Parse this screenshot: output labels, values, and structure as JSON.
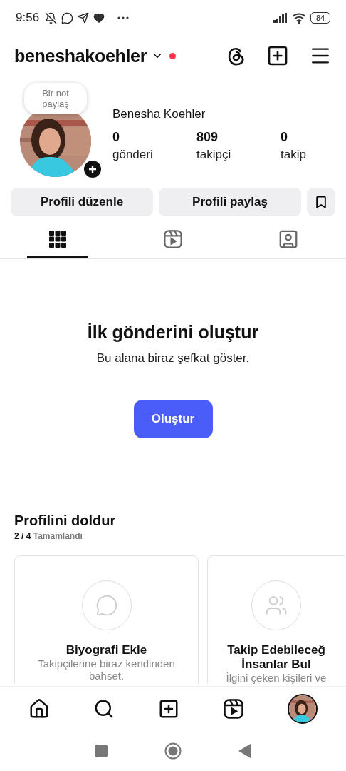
{
  "status_bar": {
    "time": "9:56",
    "battery": "84"
  },
  "header": {
    "username": "beneshakoehler",
    "notification_dot": true
  },
  "profile": {
    "note": "Bir not paylaş",
    "name": "Benesha Koehler",
    "stats": [
      {
        "value": "0",
        "label": "gönderi"
      },
      {
        "value": "809",
        "label": "takipçi"
      },
      {
        "value": "0",
        "label": "takip"
      }
    ]
  },
  "buttons": [
    "Profili düzenle",
    "Profili paylaş"
  ],
  "tabs": [
    {
      "kind": "grid",
      "selected": true
    },
    {
      "kind": "reels",
      "selected": false
    },
    {
      "kind": "tagged",
      "selected": false
    }
  ],
  "empty_state": {
    "title": "İlk gönderini oluştur",
    "subtitle": "Bu alana biraz şefkat göster.",
    "button": "Oluştur"
  },
  "completion": {
    "title": "Profilini doldur",
    "progress": "2 / 4",
    "progress_label": "Tamamlandı",
    "cards": [
      {
        "kind": "bio",
        "title": "Biyografi Ekle",
        "description": "Takipçilerine biraz kendinden bahset."
      },
      {
        "kind": "people",
        "title": "Takip Edebileceğ\nİnsanlar Bul",
        "description": "İlgini çeken kişileri ve"
      }
    ]
  },
  "bottom_nav": [
    {
      "kind": "home",
      "selected": false
    },
    {
      "kind": "search",
      "selected": false
    },
    {
      "kind": "create",
      "selected": false
    },
    {
      "kind": "reels",
      "selected": false
    },
    {
      "kind": "profile",
      "selected": true
    }
  ]
}
